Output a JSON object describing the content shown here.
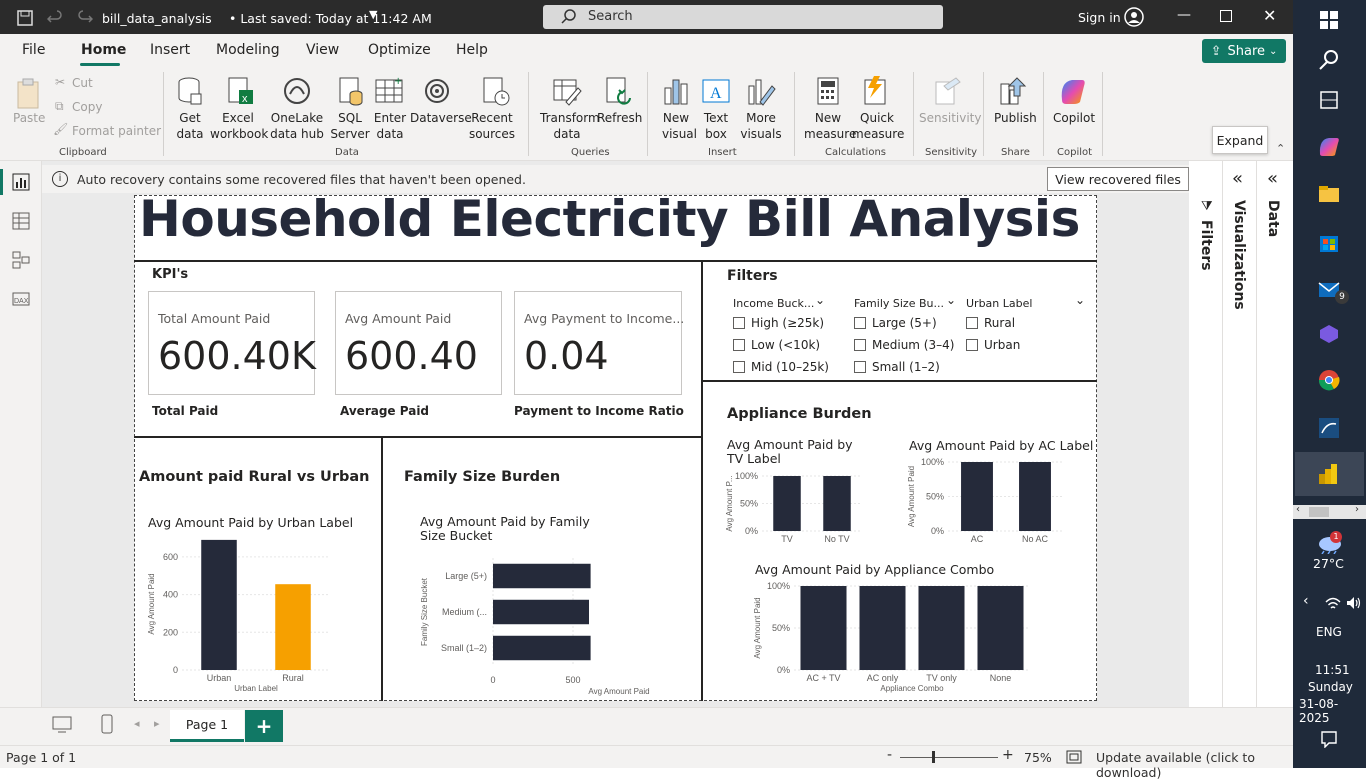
{
  "titlebar": {
    "filename": "bill_data_analysis",
    "saved": "• Last saved: Today at 11:42 AM",
    "search": "Search",
    "signin": "Sign in"
  },
  "menu": {
    "file": "File",
    "home": "Home",
    "insert": "Insert",
    "modeling": "Modeling",
    "view": "View",
    "optimize": "Optimize",
    "help": "Help",
    "share": "Share"
  },
  "ribbon": {
    "clipboard": {
      "paste": "Paste",
      "cut": "Cut",
      "copy": "Copy",
      "format_painter": "Format painter",
      "group": "Clipboard"
    },
    "data": {
      "get_data": "Get data",
      "excel": "Excel workbook",
      "onelake": "OneLake data hub",
      "sql": "SQL Server",
      "enter": "Enter data",
      "dataverse": "Dataverse",
      "recent": "Recent sources",
      "group": "Data"
    },
    "queries": {
      "transform": "Transform data",
      "refresh": "Refresh",
      "group": "Queries"
    },
    "insert": {
      "new_visual": "New visual",
      "text_box": "Text box",
      "more_visuals": "More visuals",
      "group": "Insert"
    },
    "calculations": {
      "new_measure": "New measure",
      "quick_measure": "Quick measure",
      "group": "Calculations"
    },
    "sensitivity": {
      "label": "Sensitivity",
      "group": "Sensitivity"
    },
    "share": {
      "publish": "Publish",
      "group": "Share"
    },
    "copilot": {
      "label": "Copilot",
      "group": "Copilot"
    }
  },
  "tooltip": "Expand",
  "infobar": {
    "message": "Auto recovery contains some recovered files that haven't been opened.",
    "button": "View recovered files"
  },
  "report": {
    "title": "Household Electricity Bill Analysis",
    "kpi_header": "KPI's",
    "kpis": [
      {
        "label": "Total Amount Paid",
        "value": "600.40K",
        "caption": "Total Paid"
      },
      {
        "label": "Avg Amount Paid",
        "value": "600.40",
        "caption": "Average Paid"
      },
      {
        "label": "Avg Payment to Income...",
        "value": "0.04",
        "caption": "Payment to Income Ratio"
      }
    ],
    "filters": {
      "header": "Filters",
      "slicers": [
        {
          "title": "Income Buck...",
          "options": [
            "High (≥25k)",
            "Low (<10k)",
            "Mid (10–25k)"
          ]
        },
        {
          "title": "Family Size Bu...",
          "options": [
            "Large (5+)",
            "Medium (3–4)",
            "Small (1–2)"
          ]
        },
        {
          "title": "Urban Label",
          "options": [
            "Rural",
            "Urban"
          ]
        }
      ]
    },
    "rural_header": "Amount paid Rural vs Urban",
    "family_header": "Family Size Burden",
    "appliance_header": "Appliance Burden"
  },
  "chart_data": [
    {
      "type": "bar",
      "title": "Avg Amount Paid by Urban Label",
      "xlabel": "Urban Label",
      "ylabel": "Avg Amount Paid",
      "categories": [
        "Urban",
        "Rural"
      ],
      "values": [
        690,
        455
      ],
      "colors": [
        "#252a3a",
        "#f6a000"
      ],
      "ylim": [
        0,
        700
      ],
      "yticks": [
        "0",
        "200",
        "400",
        "600"
      ]
    },
    {
      "type": "bar",
      "orientation": "horizontal",
      "title": "Avg Amount Paid by Family Size Bucket",
      "xlabel": "Avg Amount Paid",
      "ylabel": "Family Size Bucket",
      "categories": [
        "Large (5+)",
        "Medium (...",
        "Small (1–2)"
      ],
      "values": [
        610,
        600,
        610
      ],
      "xlim": [
        0,
        700
      ],
      "xticks": [
        "0",
        "500"
      ]
    },
    {
      "type": "bar",
      "title": "Avg Amount Paid by TV Label",
      "ylabel": "Avg Amount P...",
      "categories": [
        "TV",
        "No TV"
      ],
      "values": [
        100,
        100
      ],
      "ylim": [
        0,
        100
      ],
      "yticks": [
        "0%",
        "50%",
        "100%"
      ]
    },
    {
      "type": "bar",
      "title": "Avg Amount Paid by AC Label",
      "ylabel": "Avg Amount Paid",
      "categories": [
        "AC",
        "No AC"
      ],
      "values": [
        100,
        100
      ],
      "ylim": [
        0,
        100
      ],
      "yticks": [
        "0%",
        "50%",
        "100%"
      ]
    },
    {
      "type": "bar",
      "title": "Avg Amount Paid by Appliance Combo",
      "xlabel": "Appliance Combo",
      "ylabel": "Avg Amount Paid",
      "categories": [
        "AC + TV",
        "AC only",
        "TV only",
        "None"
      ],
      "values": [
        100,
        100,
        100,
        100
      ],
      "ylim": [
        0,
        100
      ],
      "yticks": [
        "0%",
        "50%",
        "100%"
      ]
    }
  ],
  "panes": {
    "filters": "Filters",
    "visualizations": "Visualizations",
    "data": "Data"
  },
  "bottom": {
    "page": "Page 1",
    "add": "+"
  },
  "status": {
    "page_of": "Page 1 of 1",
    "zoom": "75%",
    "update": "Update available (click to download)"
  },
  "taskbar": {
    "weather": "27°C",
    "lang": "ENG",
    "time": "11:51",
    "day": "Sunday",
    "date": "31-08-2025",
    "mail_badge": "9",
    "weather_badge": "1"
  }
}
